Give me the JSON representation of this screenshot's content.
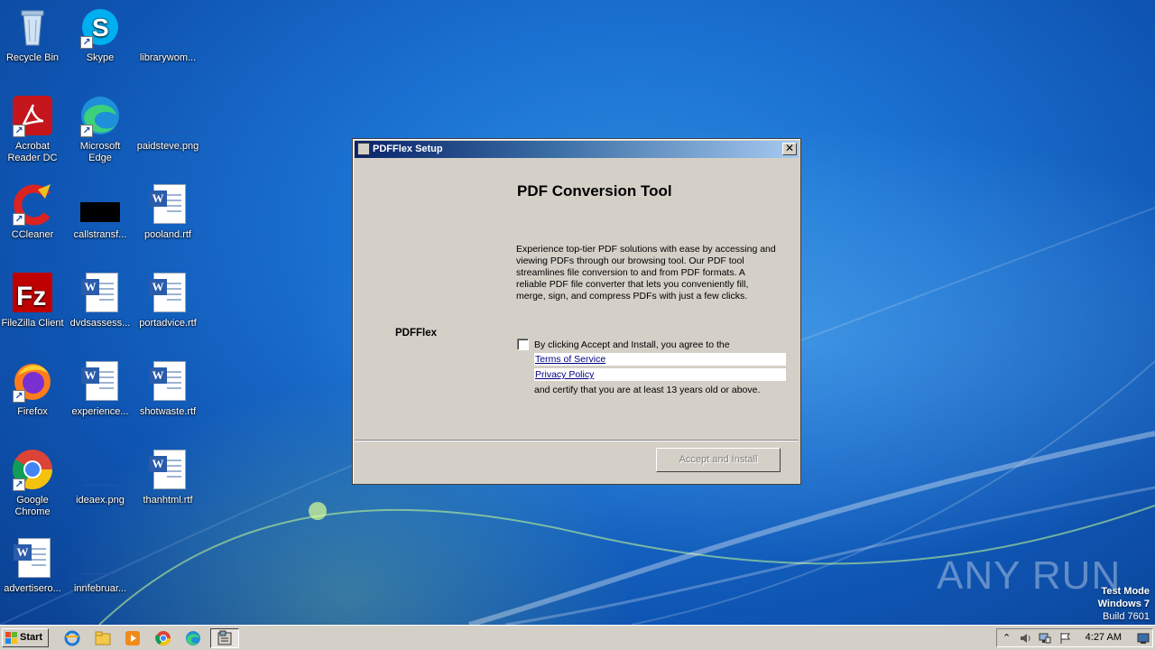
{
  "desktop": {
    "icons": [
      {
        "label": "Recycle Bin",
        "icon": "recycle-bin-icon"
      },
      {
        "label": "Skype",
        "icon": "skype-icon"
      },
      {
        "label": "librarywom...",
        "icon": "image-file-icon"
      },
      {
        "label": "Acrobat Reader DC",
        "icon": "acrobat-icon"
      },
      {
        "label": "Microsoft Edge",
        "icon": "edge-icon"
      },
      {
        "label": "paidsteve.png",
        "icon": "image-file-icon"
      },
      {
        "label": "CCleaner",
        "icon": "ccleaner-icon"
      },
      {
        "label": "callstransf...",
        "icon": "image-file-icon"
      },
      {
        "label": "pooland.rtf",
        "icon": "word-document-icon"
      },
      {
        "label": "FileZilla Client",
        "icon": "filezilla-icon"
      },
      {
        "label": "dvdsassess...",
        "icon": "word-document-icon"
      },
      {
        "label": "portadvice.rtf",
        "icon": "word-document-icon"
      },
      {
        "label": "Firefox",
        "icon": "firefox-icon"
      },
      {
        "label": "experience...",
        "icon": "word-document-icon"
      },
      {
        "label": "shotwaste.rtf",
        "icon": "word-document-icon"
      },
      {
        "label": "Google Chrome",
        "icon": "chrome-icon"
      },
      {
        "label": "ideaex.png",
        "icon": "image-file-icon"
      },
      {
        "label": "thanhtml.rtf",
        "icon": "word-document-icon"
      },
      {
        "label": "advertisero...",
        "icon": "word-document-icon"
      },
      {
        "label": "innfebruar...",
        "icon": "image-file-icon"
      }
    ]
  },
  "dialog": {
    "title": "PDFFlex Setup",
    "heading": "PDF Conversion Tool",
    "description": "Experience top-tier PDF solutions with ease by accessing and viewing PDFs through our browsing tool. Our PDF tool streamlines file conversion to and from PDF formats. A reliable PDF file converter that lets you conveniently fill, merge, sign, and compress PDFs with just a few clicks.",
    "brand": "PDFFlex",
    "agree_text": "By clicking Accept and Install, you agree to the",
    "terms_link": "Terms of Service",
    "privacy_link": "Privacy Policy",
    "certify_text": "and certify that you are at least 13 years old or above.",
    "accept_button": "Accept and Install",
    "checkbox_checked": false,
    "accept_enabled": false
  },
  "watermark": {
    "text": "ANY RUN",
    "test_mode": "Test Mode",
    "os": "Windows 7",
    "build": "Build 7601"
  },
  "taskbar": {
    "start_label": "Start",
    "quick_launch": [
      "ie-icon",
      "explorer-folder-icon",
      "media-player-icon",
      "chrome-icon",
      "edge-icon"
    ],
    "active_window_icon": "pdfflex-setup-icon",
    "clock": "4:27 AM",
    "tray_icons": [
      "show-hidden-icon",
      "volume-icon",
      "network-icon",
      "action-center-flag-icon",
      "show-desktop-icon"
    ]
  }
}
